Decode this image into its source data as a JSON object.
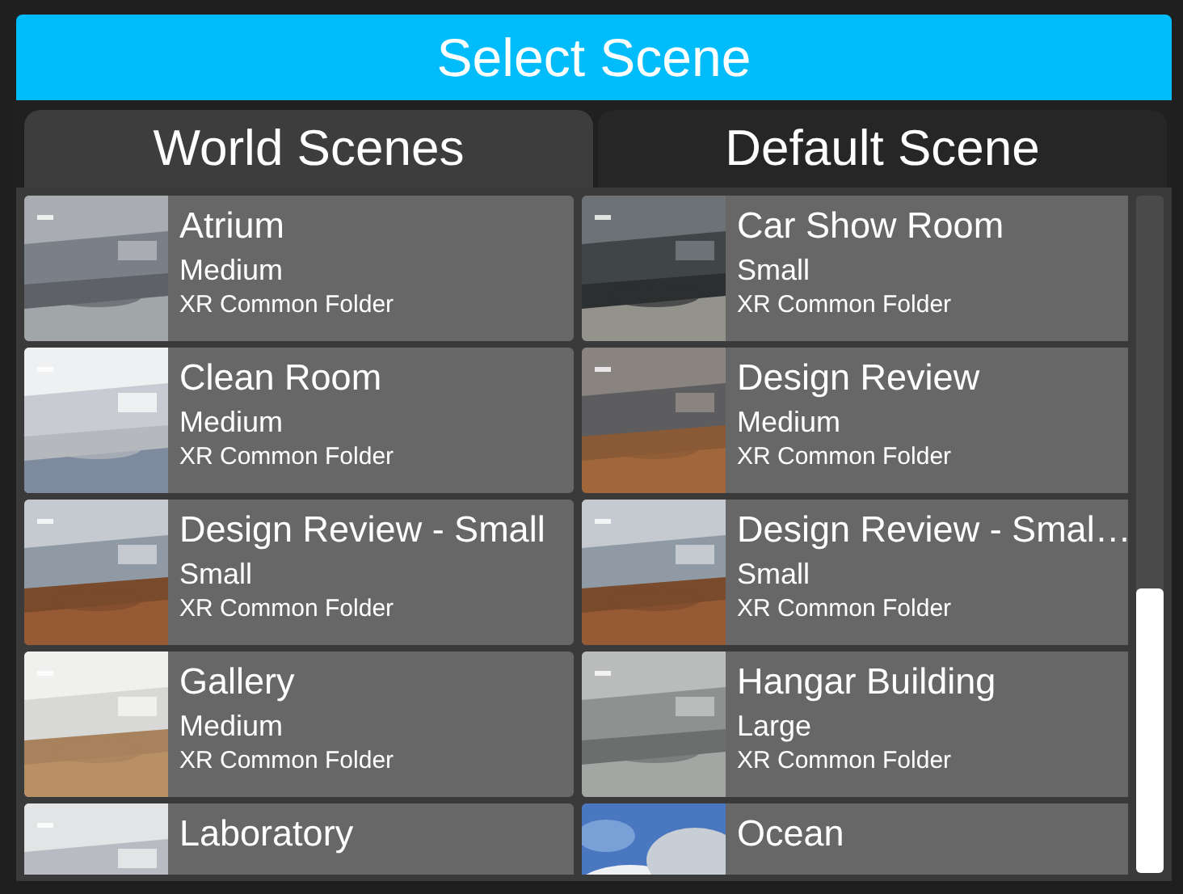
{
  "title": "Select Scene",
  "tabs": [
    {
      "label": "World Scenes",
      "selected": true
    },
    {
      "label": "Default Scene",
      "selected": false
    }
  ],
  "scenes": [
    {
      "name": "Atrium",
      "size": "Medium",
      "location": "XR Common Folder"
    },
    {
      "name": "Car Show Room",
      "size": "Small",
      "location": "XR Common Folder"
    },
    {
      "name": "Clean Room",
      "size": "Medium",
      "location": "XR Common Folder"
    },
    {
      "name": "Design Review",
      "size": "Medium",
      "location": "XR Common Folder"
    },
    {
      "name": "Design Review - Small",
      "size": "Small",
      "location": "XR Common Folder"
    },
    {
      "name": "Design Review - Smal…",
      "size": "Small",
      "location": "XR Common Folder"
    },
    {
      "name": "Gallery",
      "size": "Medium",
      "location": "XR Common Folder"
    },
    {
      "name": "Hangar Building",
      "size": "Large",
      "location": "XR Common Folder"
    },
    {
      "name": "Laboratory"
    },
    {
      "name": "Ocean"
    }
  ]
}
